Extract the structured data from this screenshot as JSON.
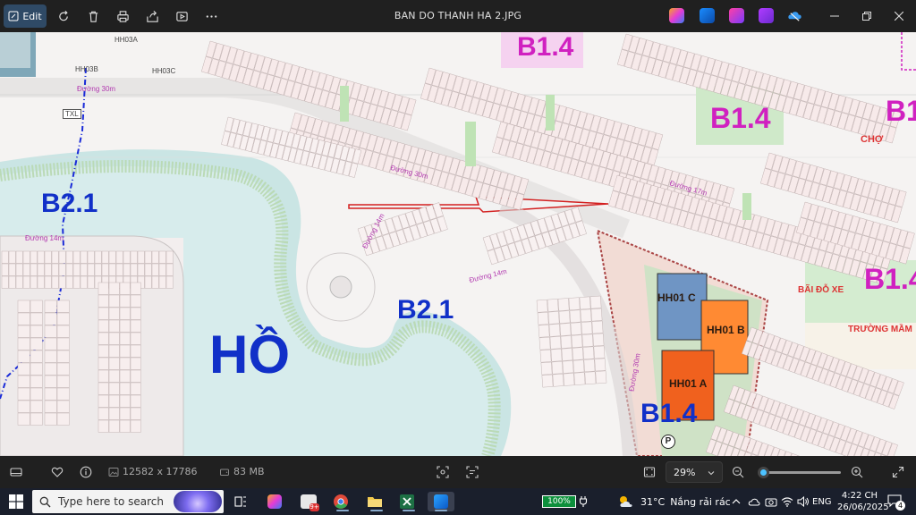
{
  "titlebar": {
    "edit_label": "Edit",
    "title": "BAN DO THANH HA 2.JPG",
    "tools": [
      "rotate-icon",
      "delete-icon",
      "print-icon",
      "share-icon",
      "slideshow-icon",
      "more-icon"
    ],
    "apps": [
      "copilot-icon",
      "photo-edit-icon",
      "designer-icon",
      "clipchamp-icon",
      "onedrive-icon"
    ]
  },
  "map": {
    "labels": {
      "b14_top": "B1.4",
      "b14_mid": "B1.4",
      "b14_bottom": "B1.4",
      "b1_right_top": "B1",
      "b1_right_mid": "B1.4",
      "b21_left": "B2.1",
      "b21_center": "B2.1",
      "ho": "HỒ",
      "cho": "CHỢ",
      "bai_do_xe": "BÃI ĐỖ XE",
      "truong_mam": "TRƯỜNG MẦM",
      "hh01c": "HH01 C",
      "hh01b": "HH01 B",
      "hh01a": "HH01 A",
      "txl": "TXL",
      "hh03b": "HH03B",
      "hh03c": "HH03C",
      "hh03a": "HH03A",
      "duong30_top": "Đường 30m",
      "duong30_mid": "Đường 30m",
      "duong14_a": "Đường 14m",
      "duong14_b": "Đường 14m",
      "duong14_c": "Đường 14m",
      "duong17_a": "Đường 17m",
      "duong30_vert": "Đường 30m",
      "parking": "P"
    }
  },
  "statusbar": {
    "dimensions": "12582 x 17786",
    "filesize": "83 MB",
    "zoom": "29%",
    "zoom_fraction": 0.05
  },
  "taskbar": {
    "search_placeholder": "Type here to search",
    "battery": "100%",
    "temperature": "31°C",
    "weather": "Nắng rải rác",
    "language": "ENG",
    "time": "4:22 CH",
    "date": "26/06/2025",
    "notifications": "4"
  }
}
